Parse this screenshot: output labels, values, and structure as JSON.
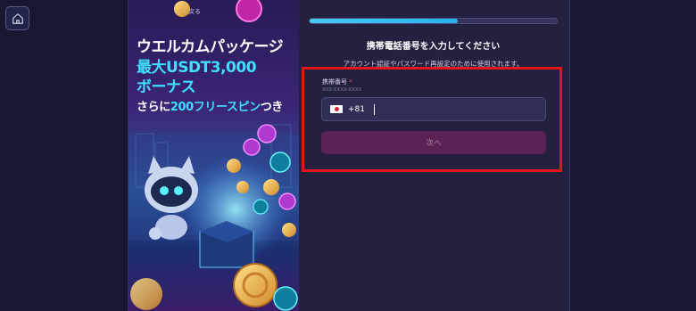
{
  "banner": {
    "line1": "ウエルカムパッケージ",
    "line2": "最大USDT3,000",
    "line3": "ボーナス",
    "line4_prefix": "さらに",
    "line4_highlight": "200フリースピン",
    "line4_suffix": "つき"
  },
  "form": {
    "back_label": "‹ 戻る",
    "progress": 0.6,
    "title": "携帯電話番号を入力してください",
    "subtitle": "アカウント認証やパスワード再設定のために使用されます。",
    "phone_label": "携帯番号",
    "required_mark": "*",
    "phone_hint": "XXX-XXXX-XXXX",
    "dial_code": "+81",
    "phone_value": "",
    "next_label": "次へ"
  },
  "colors": {
    "background": "#181733",
    "panel": "#23213f",
    "progress": "#26b3ef",
    "button": "#5b2355",
    "highlight": "#e4161b",
    "banner_accent": "#3fe0ff"
  },
  "icons": {
    "home": "home-icon",
    "flag": "japan-flag-icon"
  }
}
